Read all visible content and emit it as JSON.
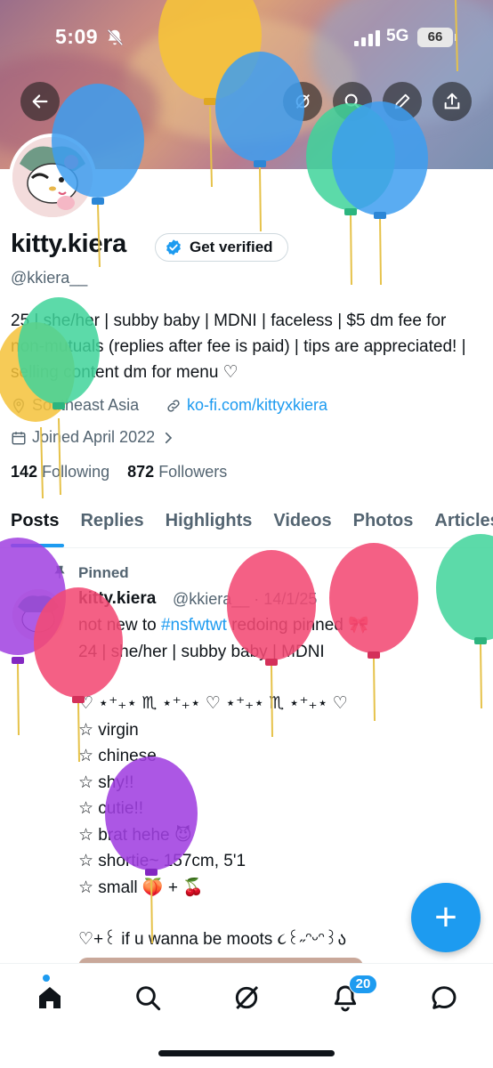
{
  "status_bar": {
    "time": "5:09",
    "network": "5G",
    "battery": "66"
  },
  "header": {
    "back_icon": "arrow-left-icon",
    "grok_icon": "grok-icon",
    "search_icon": "search-icon",
    "edit_icon": "pencil-icon",
    "share_icon": "share-icon"
  },
  "profile": {
    "name": "kitty.kiera",
    "verify_label": "Get verified",
    "handle": "@kkiera__",
    "bio": "25 | she/her | subby baby | MDNI | faceless | $5 dm fee for non-mutuals (replies after fee is paid) | tips are appreciated! | selling content dm for menu ♡",
    "location": "Southeast Asia",
    "website": "ko-fi.com/kittyxkiera",
    "joined": "Joined April 2022",
    "following_count": "142",
    "following_label": "Following",
    "followers_count": "872",
    "followers_label": "Followers"
  },
  "tabs": [
    "Posts",
    "Replies",
    "Highlights",
    "Videos",
    "Photos",
    "Articles"
  ],
  "pinned_tweet": {
    "pinned_label": "Pinned",
    "name": "kitty.kiera",
    "handle_time": "@kkiera__ · 14/1/25",
    "line1_prefix": "not new to ",
    "hashtag": "#nsfwtwt",
    "line1_suffix": " redoing pinned 🎀",
    "line2": "24 | she/her | subby baby | MDNI",
    "divider": "♡ ⋆⁺₊⋆ ♏︎ ⋆⁺₊⋆ ♡ ⋆⁺₊⋆ ♏︎ ⋆⁺₊⋆ ♡",
    "items": [
      "☆ virgin",
      "☆ chinese",
      "☆ shy!!",
      "☆ cutie!!",
      "☆ brat hehe 😈",
      "☆ shortie~ 157cm, 5'1",
      "☆ small 🍑 + 🍒"
    ],
    "footer": "♡+꒰ if u wanna be moots ૮꒰˶ᵔᵕᵔ꒱ა"
  },
  "fab_label": "+",
  "bottom_nav": {
    "notification_count": "20"
  },
  "colors": {
    "accent": "#1d9bf0",
    "text": "#0f1419",
    "muted": "#536471"
  }
}
